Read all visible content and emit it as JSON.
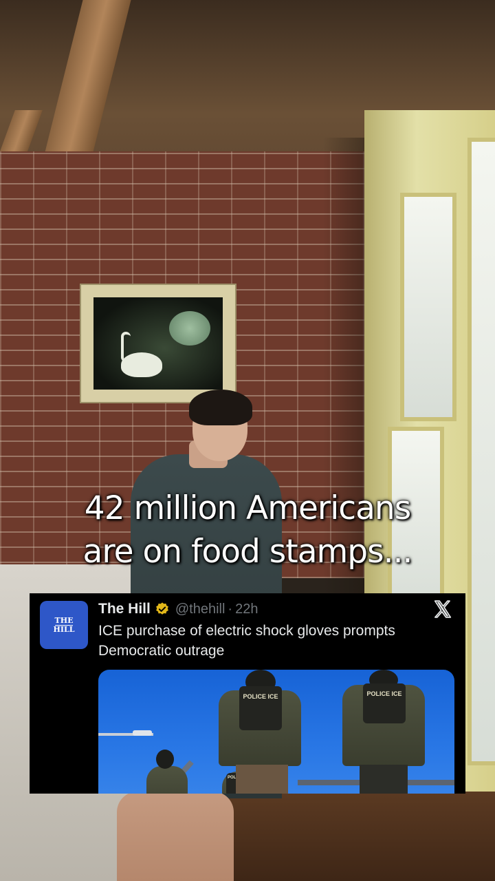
{
  "overlay": {
    "caption_lines": [
      "42 million Americans",
      "are on food stamps..."
    ]
  },
  "tweet": {
    "avatar_lines": [
      "THE",
      "HILL"
    ],
    "author_name": "The Hill",
    "handle": "@thehill",
    "separator": "·",
    "time_ago": "22h",
    "text": "ICE purchase of electric shock gloves prompts Democratic outrage",
    "image_vest_labels": [
      "POLICE ICE",
      "POLICE ICE",
      "POLICE ICE"
    ],
    "icons": {
      "verified": "verified-badge-icon",
      "platform": "x-logo-icon"
    }
  },
  "colors": {
    "verified_gold": "#e2b719",
    "avatar_blue": "#2e57c8",
    "tweet_bg": "#000000"
  }
}
